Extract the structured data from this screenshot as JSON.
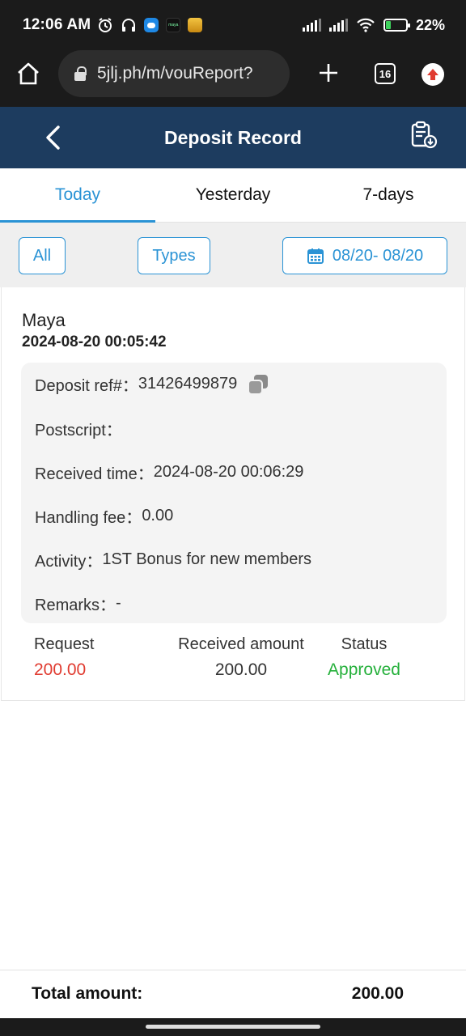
{
  "status_bar": {
    "time": "12:06 AM",
    "battery": "22%",
    "maya_badge": "maya"
  },
  "browser": {
    "url": "5jlj.ph/m/vouReport?",
    "tab_count": "16"
  },
  "header": {
    "title": "Deposit Record"
  },
  "tabs": [
    "Today",
    "Yesterday",
    "7-days"
  ],
  "filters": {
    "all": "All",
    "types": "Types",
    "date_range": "08/20- 08/20"
  },
  "record": {
    "channel": "Maya",
    "datetime": "2024-08-20 00:05:42",
    "details": [
      {
        "label": "Deposit ref#：",
        "value": "31426499879"
      },
      {
        "label": "Postscript：",
        "value": ""
      },
      {
        "label": "Received time：",
        "value": "2024-08-20 00:06:29"
      },
      {
        "label": "Handling fee：",
        "value": "0.00"
      },
      {
        "label": "Activity：",
        "value": "1ST Bonus for new members"
      },
      {
        "label": "Remarks：",
        "value": "-"
      }
    ],
    "summary": {
      "request_label": "Request",
      "request_value": "200.00",
      "received_label": "Received amount",
      "received_value": "200.00",
      "status_label": "Status",
      "status_value": "Approved"
    }
  },
  "footer": {
    "total_label": "Total amount:",
    "total_value": "200.00"
  },
  "colors": {
    "header_bg": "#1d3c5f",
    "accent_blue": "#2a93d5",
    "request_red": "#e03a2f",
    "status_green": "#25b03b"
  }
}
